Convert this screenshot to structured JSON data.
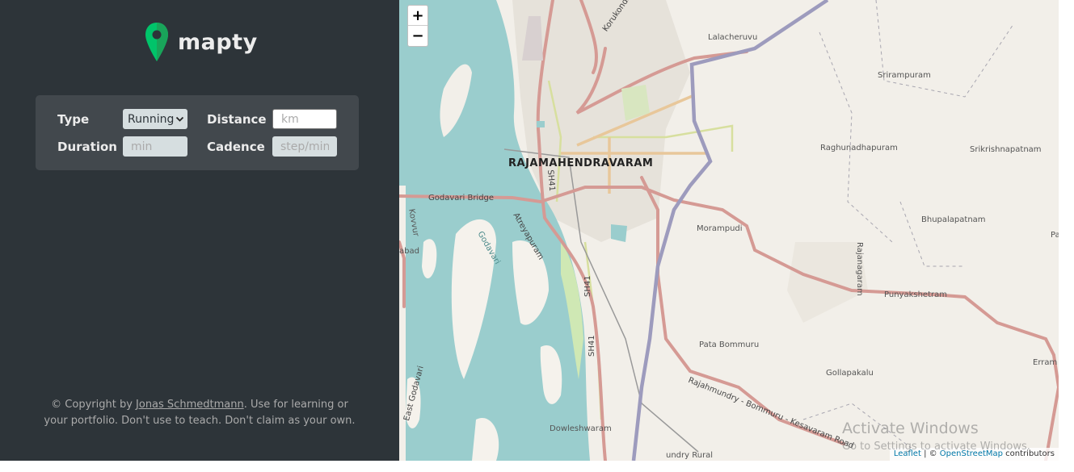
{
  "app": {
    "name": "mapty"
  },
  "form": {
    "type_label": "Type",
    "type_value": "Running",
    "distance_label": "Distance",
    "distance_placeholder": "km",
    "duration_label": "Duration",
    "duration_placeholder": "min",
    "cadence_label": "Cadence",
    "cadence_placeholder": "step/min"
  },
  "footer": {
    "prefix": "© Copyright by ",
    "author": "Jonas Schmedtmann",
    "suffix": ". Use for learning or your portfolio. Don't use to teach. Don't claim as your own."
  },
  "map": {
    "zoom_in": "+",
    "zoom_out": "−",
    "city": "RAJAMAHENDRAVARAM",
    "places": {
      "lalacheruvu": "Lalacheruvu",
      "srirampuram": "Srirampuram",
      "raghunadhapuram": "Raghunadhapuram",
      "srikrishnapatnam": "Srikrishnapatnam",
      "bhupalapatnam": "Bhupalapatnam",
      "murampudi": "Morampudi",
      "punyakshetram": "Punyakshetram",
      "pata_bommuru": "Pata Bommuru",
      "gollapakalu": "Gollapakalu",
      "dowleshwaram": "Dowleshwaram",
      "rajanagaram": "Rajanagaram",
      "kovvur": "Kovvur",
      "abad": "abad",
      "errampalem": "Erram",
      "pa": "Pa",
      "rural": "undry Rural"
    },
    "roads": {
      "korukonda": "Korukonda",
      "godavari_bridge": "Godavari Bridge",
      "sh41_a": "SH41",
      "sh41_b": "SH41",
      "sh41_c": "SH41",
      "atreyapuram": "Atreyapuram",
      "godavari": "Godavari",
      "east_godavari": "East Godavari",
      "bommuru_road": "Rajahmundry - Bommuru - Kesavaram Road"
    },
    "attribution": {
      "leaflet": "Leaflet",
      "sep": " | © ",
      "osm": "OpenStreetMap",
      "contrib": " contributors"
    },
    "colors": {
      "water": "#9acdcd",
      "land": "#f2efe9",
      "main_road": "#d59a94",
      "bypass": "#9d9bbd",
      "secondary": "#e8c79a",
      "tertiary": "#d7df9e"
    }
  },
  "watermark": {
    "line1": "Activate Windows",
    "line2": "Go to Settings to activate Windows."
  }
}
